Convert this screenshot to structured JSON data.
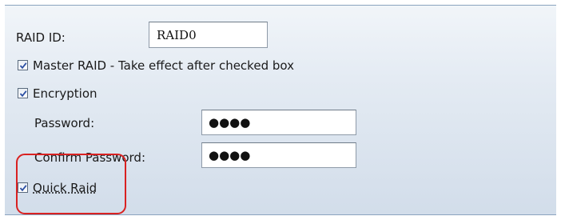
{
  "form": {
    "raid_id": {
      "label": "RAID ID:",
      "value": "RAID0"
    },
    "master_raid": {
      "label": "Master RAID - Take effect after checked box",
      "checked": true
    },
    "encryption": {
      "label": "Encryption",
      "checked": true
    },
    "password": {
      "label": "Password:",
      "value": "●●●●"
    },
    "confirm_password": {
      "label": "Confirm Password:",
      "value": "●●●●"
    },
    "quick_raid": {
      "label": "Quick Raid",
      "checked": true
    }
  },
  "colors": {
    "annotation_highlight": "#d92121",
    "checkmark": "#2b4fa3"
  }
}
